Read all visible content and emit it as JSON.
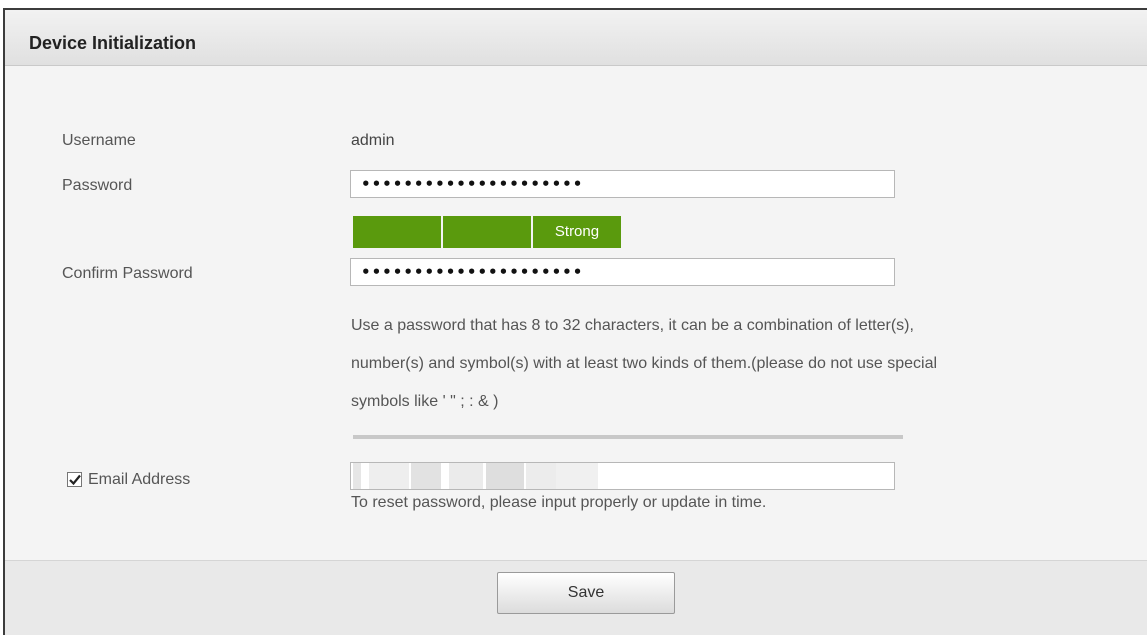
{
  "dialog": {
    "title": "Device Initialization"
  },
  "form": {
    "username_label": "Username",
    "username_value": "admin",
    "password_label": "Password",
    "password_value": "•••••••••••••••••••••",
    "strength": {
      "segments": 3,
      "label": "Strong",
      "color": "#5a9a0d"
    },
    "confirm_label": "Confirm Password",
    "confirm_value": "•••••••••••••••••••••",
    "hint_line1": "Use a password that has 8 to 32 characters, it can be a combination of letter(s),",
    "hint_line2": "number(s) and symbol(s) with at least two kinds of them.(please do not use special",
    "hint_line3": "symbols like ' \" ; : & )",
    "email_checked": true,
    "email_label": "Email Address",
    "email_note": "To reset password, please input properly or update in time."
  },
  "footer": {
    "save_label": "Save"
  }
}
